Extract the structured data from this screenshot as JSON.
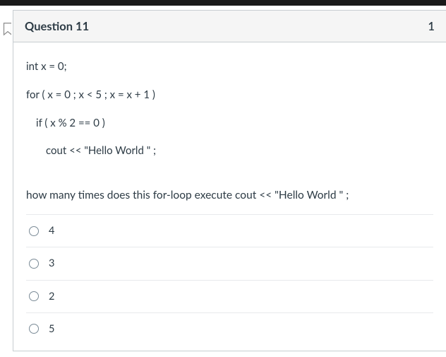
{
  "header": {
    "title": "Question 11",
    "points": "1"
  },
  "code": {
    "line1": "int x = 0;",
    "line2": "for ( x = 0 ; x < 5 ; x = x + 1 )",
    "line3": "if ( x % 2 == 0 )",
    "line4": "cout << \"Hello World \" ;"
  },
  "prompt": "how many times does this for-loop execute  cout << \"Hello World \" ;",
  "options": [
    {
      "label": "4"
    },
    {
      "label": "3"
    },
    {
      "label": "2"
    },
    {
      "label": "5"
    }
  ]
}
